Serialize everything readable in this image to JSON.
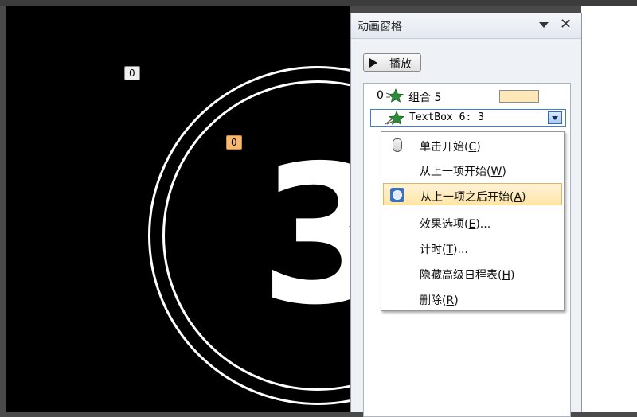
{
  "slide": {
    "big_number": "3",
    "tag_a": "0",
    "tag_b": "0"
  },
  "pane": {
    "title": "动画窗格",
    "play_label": "播放",
    "items": [
      {
        "index": "0",
        "label": "组合 5"
      },
      {
        "index": "",
        "label": "TextBox 6: 3"
      }
    ]
  },
  "menu": {
    "items": [
      {
        "text": "单击开始",
        "key": "C",
        "icon": "mouse-icon"
      },
      {
        "text": "从上一项开始",
        "key": "W",
        "icon": ""
      },
      {
        "text": "从上一项之后开始",
        "key": "A",
        "icon": "clock-icon",
        "selected": true
      },
      {
        "text": "效果选项",
        "key": "E",
        "suffix": "...",
        "icon": ""
      },
      {
        "text": "计时",
        "key": "T",
        "suffix": "...",
        "icon": ""
      },
      {
        "text": "隐藏高级日程表",
        "key": "H",
        "icon": ""
      },
      {
        "text": "删除",
        "key": "R",
        "icon": ""
      }
    ]
  },
  "colors": {
    "slide_bg": "#000000",
    "timeline_bar": "#ffe8b8",
    "menu_highlight": "#ffe6a8",
    "effect_star": "#2e8b3a"
  }
}
